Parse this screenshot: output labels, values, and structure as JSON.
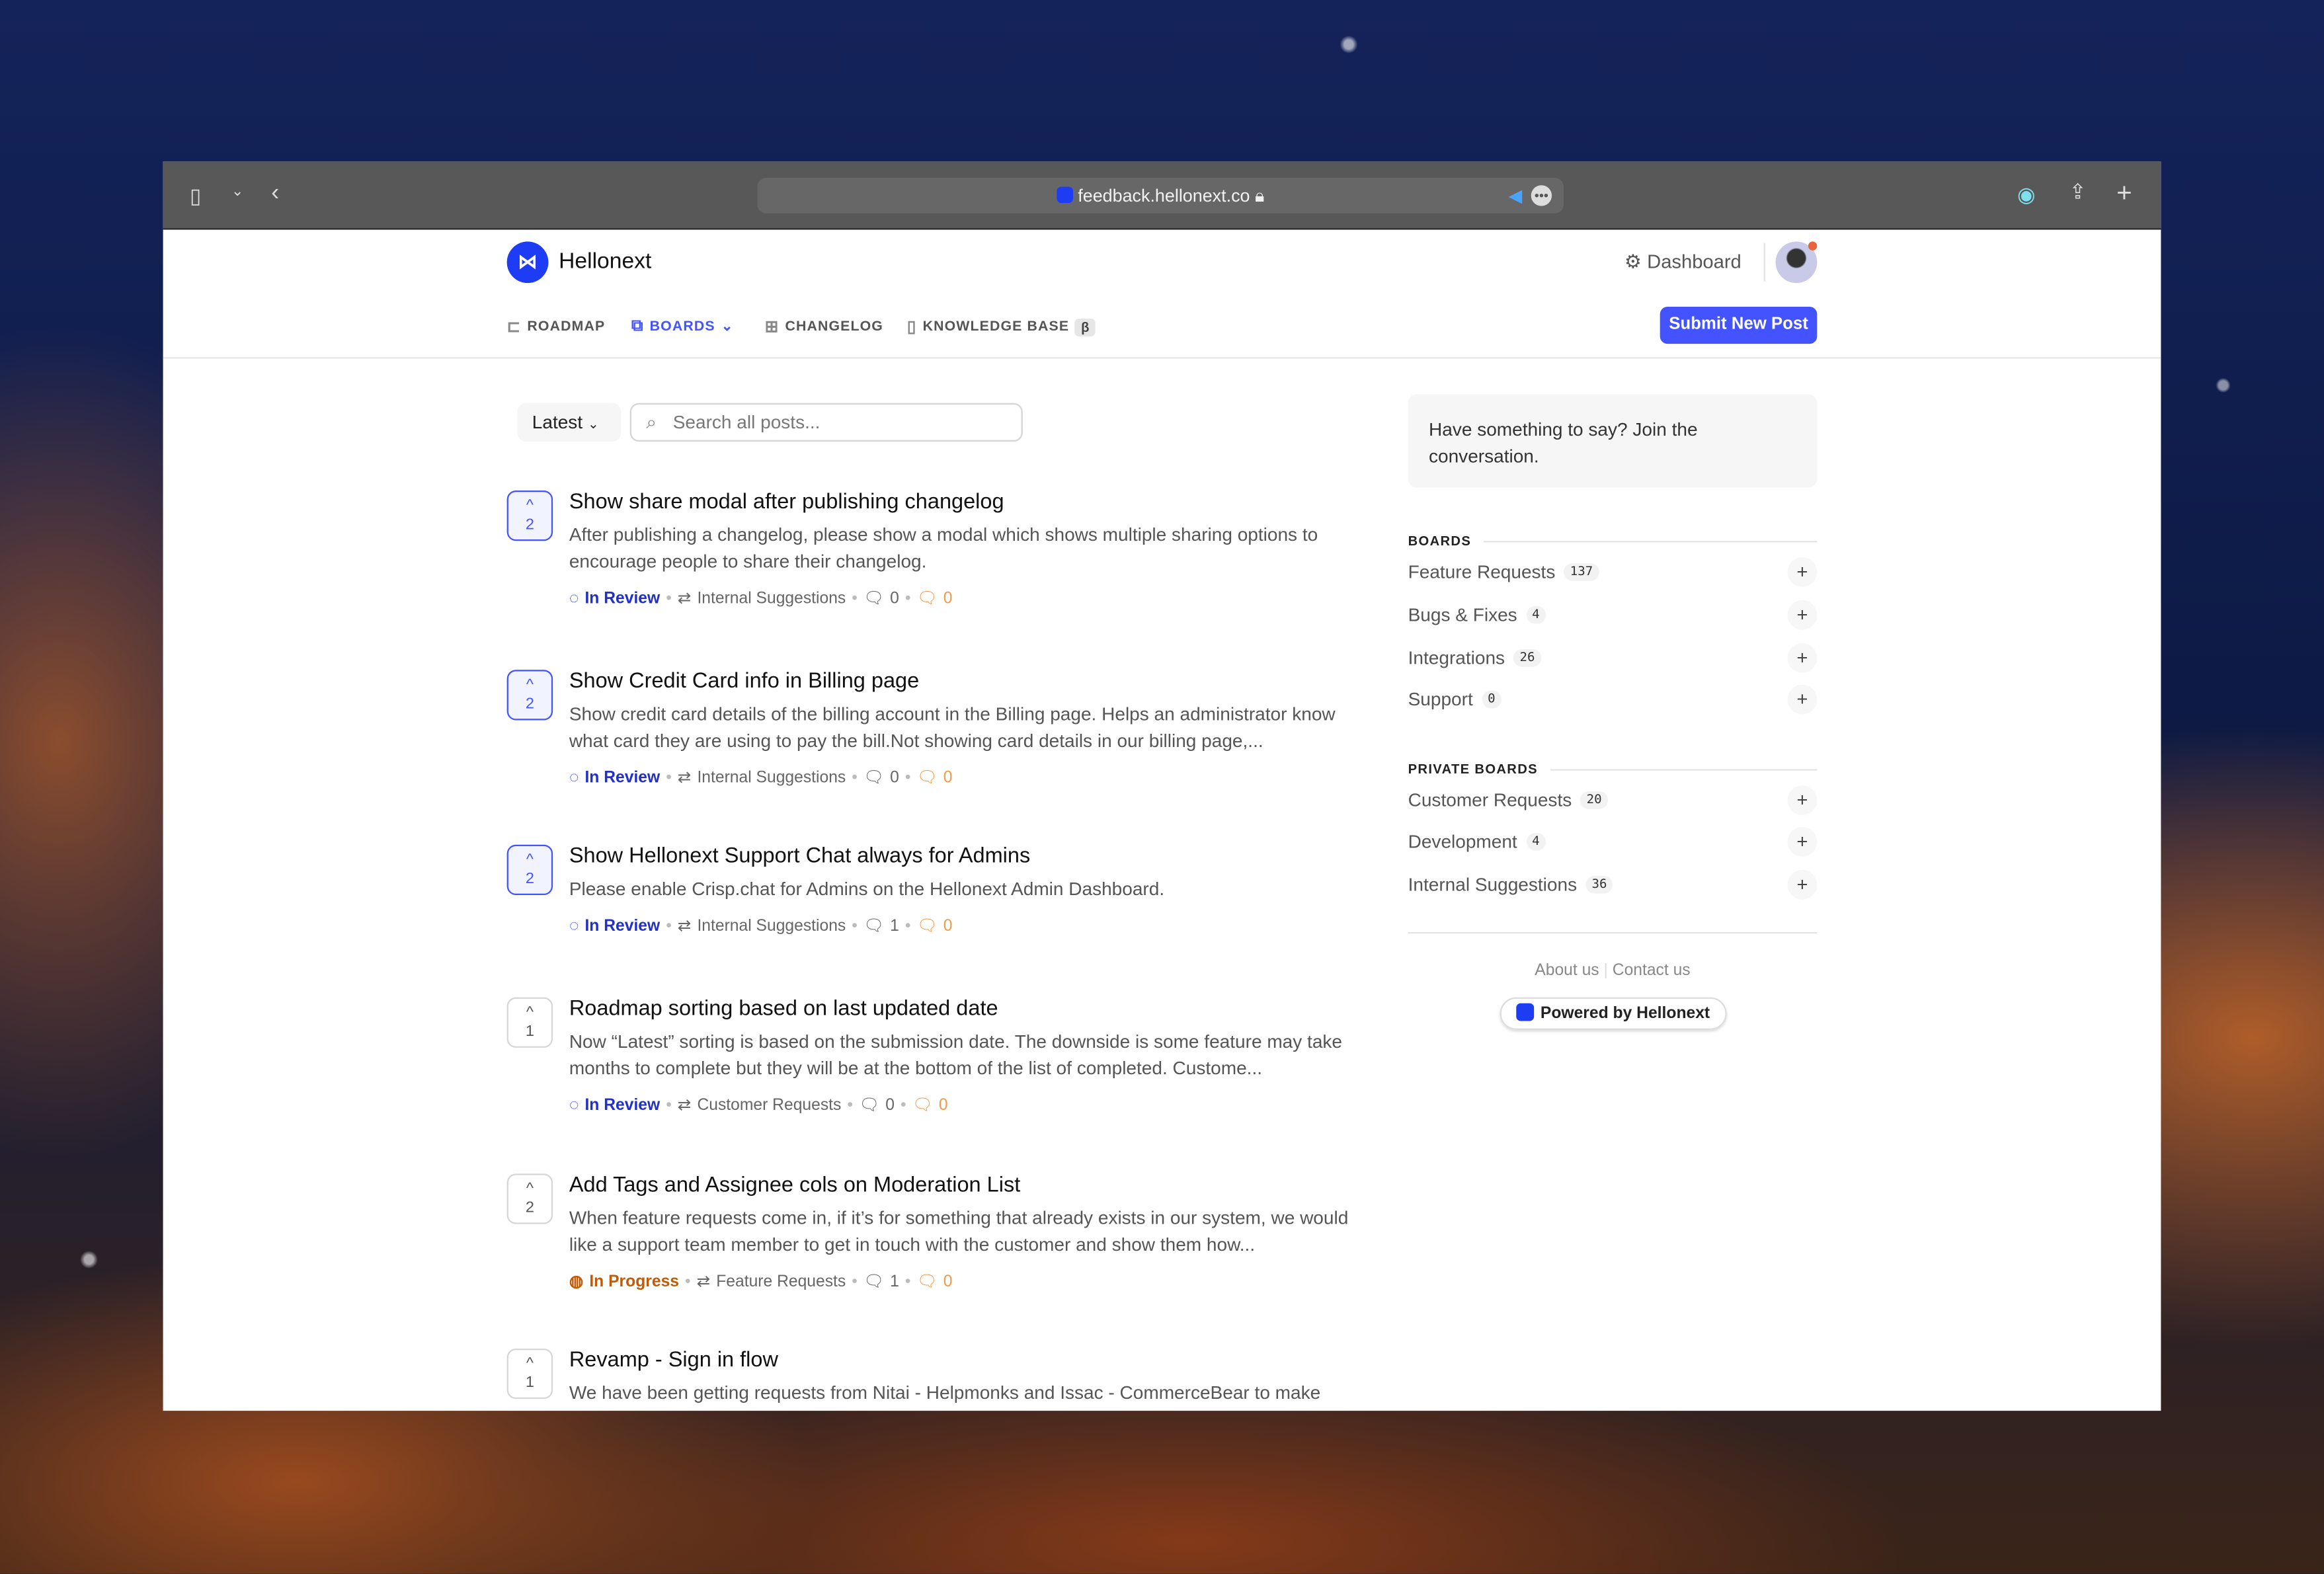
{
  "browser": {
    "url": "feedback.hellonext.co"
  },
  "header": {
    "brand": "Hellonext",
    "dashboard": "Dashboard",
    "submit": "Submit New Post",
    "nav": [
      {
        "label": "ROADMAP",
        "icon": "signpost-icon"
      },
      {
        "label": "BOARDS",
        "icon": "boards-icon",
        "active": true
      },
      {
        "label": "CHANGELOG",
        "icon": "gift-icon"
      },
      {
        "label": "KNOWLEDGE BASE",
        "icon": "book-icon",
        "badge": "β"
      }
    ]
  },
  "filters": {
    "sort": "Latest",
    "search_placeholder": "Search all posts..."
  },
  "posts": [
    {
      "votes": "2",
      "voted": true,
      "title": "Show share modal after publishing changelog",
      "desc": "After publishing a changelog, please show a modal which shows multiple sharing options to encourage people to share their changelog.",
      "status": "In Review",
      "board": "Internal Suggestions",
      "comments": "0",
      "internal": "0"
    },
    {
      "votes": "2",
      "voted": true,
      "title": "Show Credit Card info in Billing page",
      "desc": "Show credit card details of the billing account in the Billing page. Helps an administrator know what card they are using to pay the bill.Not showing card details in our billing page,...",
      "status": "In Review",
      "board": "Internal Suggestions",
      "comments": "0",
      "internal": "0"
    },
    {
      "votes": "2",
      "voted": true,
      "title": "Show Hellonext Support Chat always for Admins",
      "desc": "Please enable Crisp.chat for Admins on the Hellonext Admin Dashboard.",
      "status": "In Review",
      "board": "Internal Suggestions",
      "comments": "1",
      "internal": "0"
    },
    {
      "votes": "1",
      "voted": false,
      "title": "Roadmap sorting based on last updated date",
      "desc": "Now “Latest” sorting is based on the submission date. The downside is some feature may take months to complete but they will be at the bottom of the list of completed. Custome...",
      "status": "In Review",
      "board": "Customer Requests",
      "comments": "0",
      "internal": "0"
    },
    {
      "votes": "2",
      "voted": false,
      "title": "Add Tags and Assignee cols on Moderation List",
      "desc": "When feature requests come in, if it’s for something that already exists in our system, we would like a support team member to get in touch with the customer and show them how...",
      "status": "In Progress",
      "board": "Feature Requests",
      "comments": "1",
      "internal": "0"
    },
    {
      "votes": "1",
      "voted": false,
      "title": "Revamp - Sign in flow",
      "desc": "We have been getting requests from Nitai - Helpmonks and Issac - CommerceBear to make"
    }
  ],
  "sidebar": {
    "callout": "Have something to say? Join the conversation.",
    "boards_title": "BOARDS",
    "boards": [
      {
        "name": "Feature Requests",
        "count": "137"
      },
      {
        "name": "Bugs & Fixes",
        "count": "4"
      },
      {
        "name": "Integrations",
        "count": "26"
      },
      {
        "name": "Support",
        "count": "0"
      }
    ],
    "private_title": "PRIVATE BOARDS",
    "private": [
      {
        "name": "Customer Requests",
        "count": "20"
      },
      {
        "name": "Development",
        "count": "4"
      },
      {
        "name": "Internal Suggestions",
        "count": "36"
      }
    ],
    "about": "About us",
    "contact": "Contact us",
    "powered": "Powered by Hellonext"
  },
  "colors": {
    "accent": "#4353ff",
    "in_review": "#2330c8",
    "in_progress": "#c25b06",
    "internal": "#f29a4a"
  }
}
